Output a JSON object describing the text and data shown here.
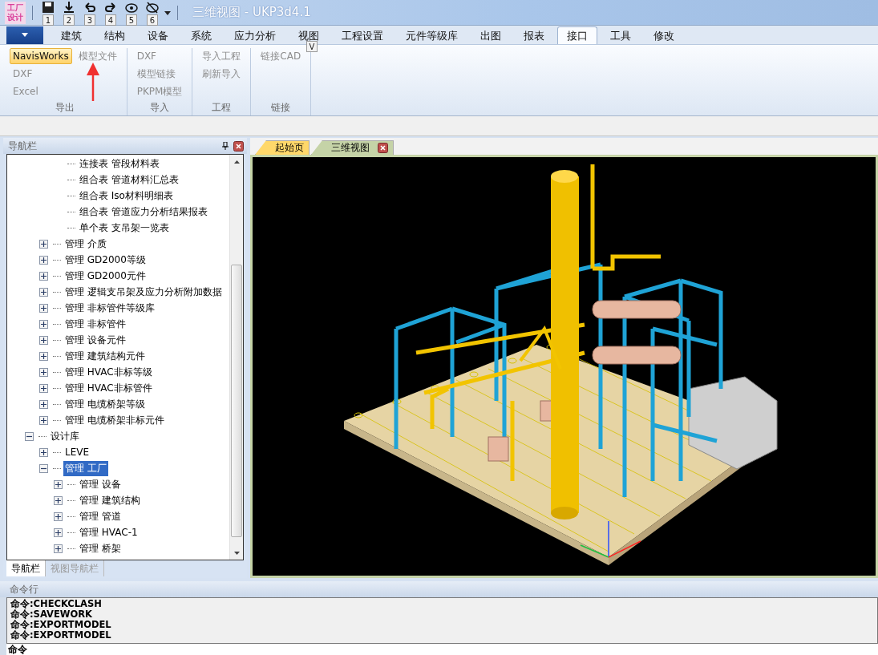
{
  "window": {
    "title": "三维视图 - UKP3d4.1",
    "logo_text": [
      "工厂",
      "设计"
    ]
  },
  "quick_access": [
    {
      "kind": "save",
      "keytip": "1"
    },
    {
      "kind": "down",
      "keytip": "2"
    },
    {
      "kind": "undo",
      "keytip": "3"
    },
    {
      "kind": "redo",
      "keytip": "4"
    },
    {
      "kind": "eye",
      "keytip": "5"
    },
    {
      "kind": "eye-off",
      "keytip": "6"
    }
  ],
  "menu_tabs": [
    {
      "label": "建筑",
      "selected": false
    },
    {
      "label": "结构",
      "selected": false
    },
    {
      "label": "设备",
      "selected": false
    },
    {
      "label": "系统",
      "selected": false
    },
    {
      "label": "应力分析",
      "selected": false
    },
    {
      "label": "视图",
      "selected": false,
      "keytip": "V"
    },
    {
      "label": "工程设置",
      "selected": false
    },
    {
      "label": "元件等级库",
      "selected": false
    },
    {
      "label": "出图",
      "selected": false
    },
    {
      "label": "报表",
      "selected": false
    },
    {
      "label": "接口",
      "selected": true
    },
    {
      "label": "工具",
      "selected": false
    },
    {
      "label": "修改",
      "selected": false
    }
  ],
  "ribbon_groups": [
    {
      "label": "导出",
      "buttons": [
        {
          "label": "NavisWorks",
          "disabled": false,
          "highlighted": true
        },
        {
          "label": "DXF",
          "disabled": true,
          "highlighted": false
        },
        {
          "label": "Excel",
          "disabled": true,
          "highlighted": false
        },
        {
          "label": "模型文件",
          "disabled": true,
          "highlighted": false
        }
      ]
    },
    {
      "label": "导入",
      "buttons": [
        {
          "label": "DXF",
          "disabled": true,
          "highlighted": false
        },
        {
          "label": "模型链接",
          "disabled": true,
          "highlighted": false
        },
        {
          "label": "PKPM模型",
          "disabled": true,
          "highlighted": false
        }
      ]
    },
    {
      "label": "工程",
      "buttons": [
        {
          "label": "导入工程",
          "disabled": true,
          "highlighted": false
        },
        {
          "label": "刷新导入",
          "disabled": true,
          "highlighted": false
        }
      ]
    },
    {
      "label": "链接",
      "buttons": [
        {
          "label": "链接CAD",
          "disabled": true,
          "highlighted": false
        }
      ]
    }
  ],
  "nav_panel": {
    "title": "导航栏",
    "tree": [
      {
        "children": [
          {
            "children": [
              {
                "label": "连接表 管段材料表"
              },
              {
                "label": "组合表 管道材料汇总表"
              },
              {
                "label": "组合表 Iso材料明细表"
              },
              {
                "label": "组合表 管道应力分析结果报表"
              },
              {
                "label": "单个表 支吊架一览表"
              }
            ]
          },
          {
            "label": "管理 介质",
            "expanded": false
          },
          {
            "label": "管理 GD2000等级",
            "expanded": false
          },
          {
            "label": "管理 GD2000元件",
            "expanded": false
          },
          {
            "label": "管理 逻辑支吊架及应力分析附加数据",
            "expanded": false
          },
          {
            "label": "管理 非标管件等级库",
            "expanded": false
          },
          {
            "label": "管理 非标管件",
            "expanded": false
          },
          {
            "label": "管理 设备元件",
            "expanded": false
          },
          {
            "label": "管理 建筑结构元件",
            "expanded": false
          },
          {
            "label": "管理 HVAC非标等级",
            "expanded": false
          },
          {
            "label": "管理 HVAC非标管件",
            "expanded": false
          },
          {
            "label": "管理 电缆桥架等级",
            "expanded": false
          },
          {
            "label": "管理 电缆桥架非标元件",
            "expanded": false
          }
        ]
      },
      {
        "label": "设计库",
        "expanded": true,
        "children": [
          {
            "label": "LEVE",
            "expanded": false
          },
          {
            "label": "管理 工厂",
            "expanded": true,
            "selected": true,
            "children": [
              {
                "label": "管理 设备",
                "expanded": false
              },
              {
                "label": "管理 建筑结构",
                "expanded": false
              },
              {
                "label": "管理 管道",
                "expanded": false
              },
              {
                "label": "管理 HVAC-1",
                "expanded": false
              },
              {
                "label": "管理 桥架",
                "expanded": false
              }
            ]
          }
        ]
      }
    ],
    "tabs": [
      {
        "label": "导航栏",
        "selected": true
      },
      {
        "label": "视图导航栏",
        "selected": false
      }
    ]
  },
  "doc_tabs": [
    {
      "label": "起始页",
      "selected": false
    },
    {
      "label": "三维视图",
      "selected": true
    }
  ],
  "command_panel": {
    "title": "命令行",
    "history": [
      "命令:CHECKCLASH",
      "命令:SAVEWORK",
      "命令:EXPORTMODEL",
      "命令:EXPORTMODEL"
    ],
    "prompt": "命令"
  }
}
